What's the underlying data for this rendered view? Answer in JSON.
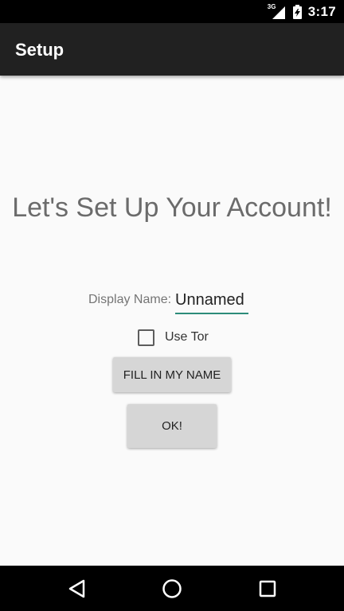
{
  "status_bar": {
    "network": "3G",
    "time": "3:17",
    "icons": [
      "signal-icon",
      "battery-icon"
    ]
  },
  "app_bar": {
    "title": "Setup"
  },
  "main": {
    "headline": "Let's Set Up Your Account!",
    "display_name_label": "Display Name:",
    "display_name_value": "Unnamed",
    "use_tor_label": "Use Tor",
    "use_tor_checked": false,
    "fill_name_button": "FILL IN MY NAME",
    "ok_button": "OK!"
  },
  "nav_bar": {
    "icons": [
      "back-icon",
      "home-icon",
      "recent-apps-icon"
    ]
  },
  "colors": {
    "app_bar": "#212121",
    "accent": "#2c8c7a",
    "button": "#d6d6d6",
    "background": "#fafafa"
  }
}
